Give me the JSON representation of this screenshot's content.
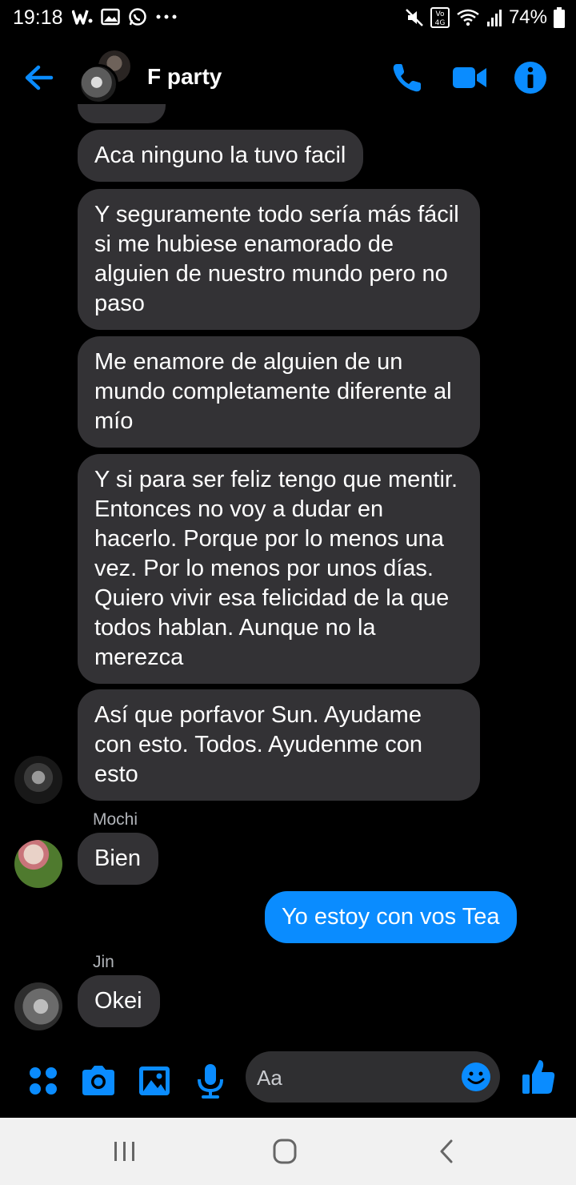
{
  "status_bar": {
    "time": "19:18",
    "battery": "74%",
    "left_icons": [
      "w-icon",
      "gallery-icon",
      "whatsapp-icon",
      "more-icon"
    ],
    "right_icons": [
      "mute-icon",
      "volte-4g-icon",
      "wifi-icon",
      "signal-icon",
      "battery-icon"
    ],
    "volte_label": "Vo)\n4G"
  },
  "header": {
    "title": "F party",
    "accent_color": "#0a8cff"
  },
  "messages": [
    {
      "id": "m1",
      "direction": "in",
      "text": "Aca ninguno la tuvo facil"
    },
    {
      "id": "m2",
      "direction": "in",
      "text": "Y seguramente todo sería más fácil si me hubiese enamorado de alguien de nuestro mundo pero no paso"
    },
    {
      "id": "m3",
      "direction": "in",
      "text": "Me enamore de alguien de un mundo completamente diferente al mío"
    },
    {
      "id": "m4",
      "direction": "in",
      "text": "Y si para ser feliz tengo que mentir. Entonces no voy a dudar en hacerlo. Porque por lo menos una vez. Por lo menos por unos días. Quiero vivir esa felicidad de la que todos hablan. Aunque no la merezca"
    },
    {
      "id": "m5",
      "direction": "in",
      "text": "Así que porfavor Sun. Ayudame con esto. Todos. Ayudenme con esto"
    },
    {
      "id": "m6",
      "direction": "in",
      "sender": "Mochi",
      "text": "Bien"
    },
    {
      "id": "m7",
      "direction": "out",
      "text": "Yo estoy con vos Tea"
    },
    {
      "id": "m8",
      "direction": "in",
      "sender": "Jin",
      "text": "Okei"
    }
  ],
  "composer": {
    "placeholder": "Aa",
    "icons": [
      "apps-icon",
      "camera-icon",
      "image-icon",
      "microphone-icon",
      "emoji-icon",
      "like-icon"
    ]
  },
  "navbar": {
    "icons": [
      "recents-icon",
      "home-icon",
      "back-icon"
    ]
  }
}
